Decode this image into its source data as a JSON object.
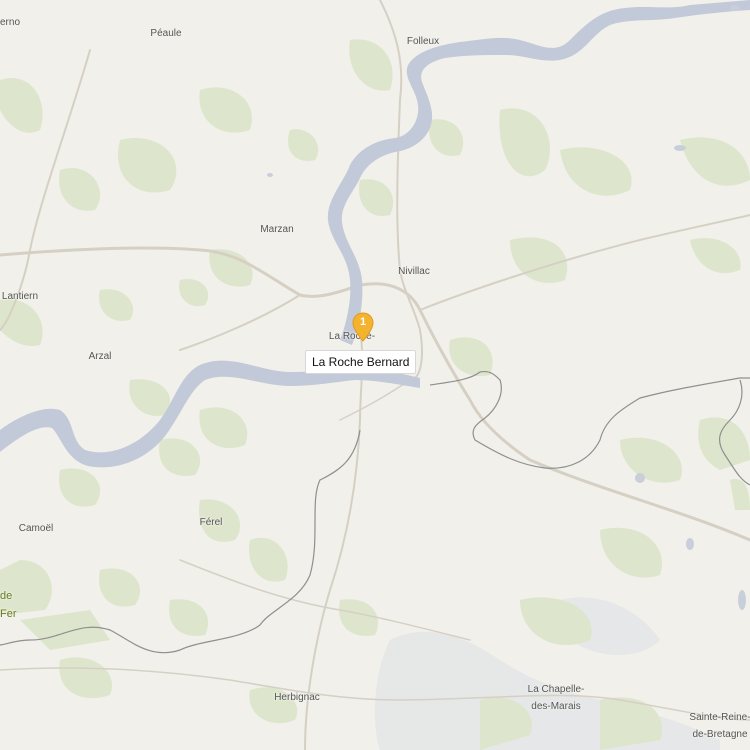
{
  "map": {
    "places": {
      "perno": "erno",
      "peaule": "Péaule",
      "folleux": "Folleux",
      "marzan": "Marzan",
      "nivillac": "Nivillac",
      "lantiern": "Lantiern",
      "la_roche_small": "La Roche-",
      "arzal": "Arzal",
      "camoel": "Camoël",
      "ferel": "Férel",
      "herbignac": "Herbignac",
      "chapelle_1": "La Chapelle-",
      "chapelle_2": "des-Marais",
      "sainte_reine_1": "Sainte-Reine-",
      "sainte_reine_2": "de-Bretagne",
      "green_1": "de",
      "green_2": "Fer"
    },
    "marker": {
      "count": "1",
      "color": "#f4b32e"
    },
    "callout": {
      "label": "La Roche Bernard"
    },
    "colors": {
      "water": "#c2c9d8",
      "land": "#f1f0ea",
      "vegetation": "#dde6cc",
      "road": "#d2ccc0",
      "border": "#8a8a8a"
    }
  }
}
